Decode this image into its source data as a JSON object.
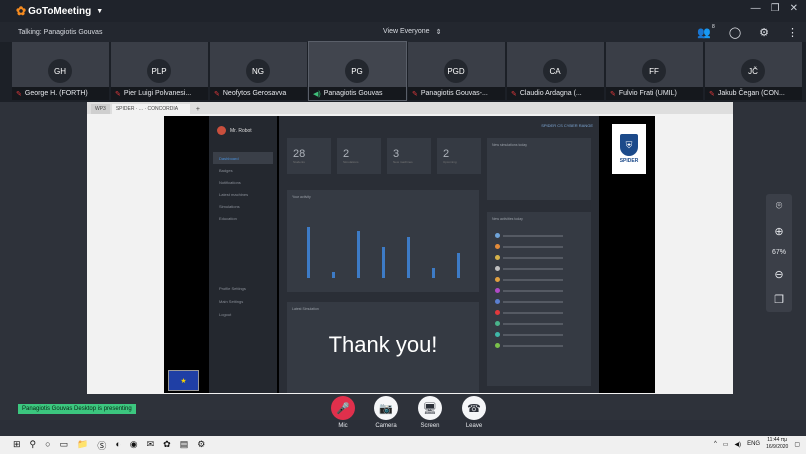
{
  "app": {
    "name": "GoToMeeting"
  },
  "window_controls": [
    "—",
    "❐",
    "✕"
  ],
  "talkbar": {
    "talking": "Talking: Panagiotis Gouvas",
    "view": "View Everyone",
    "attendee_count": "8"
  },
  "participants": [
    {
      "initials": "GH",
      "name": "George H. (FORTH)",
      "muted": true
    },
    {
      "initials": "PLP",
      "name": "Pier Luigi Polvanesi...",
      "muted": true
    },
    {
      "initials": "NG",
      "name": "Neofytos Gerosavva",
      "muted": true
    },
    {
      "initials": "PG",
      "name": "Panagiotis Gouvas",
      "muted": false
    },
    {
      "initials": "PGD",
      "name": "Panagiotis Gouvas-...",
      "muted": true
    },
    {
      "initials": "CA",
      "name": "Claudio Ardagna (...",
      "muted": true
    },
    {
      "initials": "FF",
      "name": "Fulvio Frati (UMIL)",
      "muted": true
    },
    {
      "initials": "JČ",
      "name": "Jakub Čegan (CON...",
      "muted": true
    }
  ],
  "shared": {
    "tabs": [
      "WP3",
      "SPIDER · ... · CONCORDIA",
      "+"
    ],
    "user": "Mr. Robot",
    "menu": [
      "Dashboard",
      "Badges",
      "Notifications",
      "Latest machines",
      "Simulations",
      "Education"
    ],
    "menu2": [
      "Profile Settings",
      "Main Settings",
      "Logout"
    ],
    "stats": [
      {
        "num": "28",
        "cap": "Students"
      },
      {
        "num": "2",
        "cap": "Simulations"
      },
      {
        "num": "3",
        "cap": "New machines"
      },
      {
        "num": "2",
        "cap": "Upcoming"
      }
    ],
    "link": "SPIDER CS CYBER RANGE",
    "panel_headers": [
      "New simulations today",
      "Your activity",
      "Latest Simulation",
      "New activities today"
    ],
    "thanks": "Thank you!",
    "bars": [
      78,
      10,
      73,
      48,
      63,
      15,
      38
    ],
    "activity_colors": [
      "#6fa3d8",
      "#e38b3a",
      "#d6b24a",
      "#c0c0c0",
      "#e0a040",
      "#b04ac6",
      "#5b7fd0",
      "#e2393c",
      "#4ab38a",
      "#3fb7a8",
      "#7ac04a"
    ],
    "logo_text": "SPIDER",
    "eu_flag": "★"
  },
  "side_controls": {
    "zoom": "67%"
  },
  "presenting": "Panagiotis Gouvas Desktop is presenting",
  "controls": [
    {
      "label": "Mic",
      "icon": "🎤",
      "red": true
    },
    {
      "label": "Camera",
      "icon": "📷",
      "red": false
    },
    {
      "label": "Screen",
      "icon": "🖥",
      "red": false
    },
    {
      "label": "Leave",
      "icon": "☎",
      "red": false
    }
  ],
  "taskbar": {
    "lang": "ENG",
    "time": "11:44 πμ",
    "date": "16/9/2020"
  }
}
